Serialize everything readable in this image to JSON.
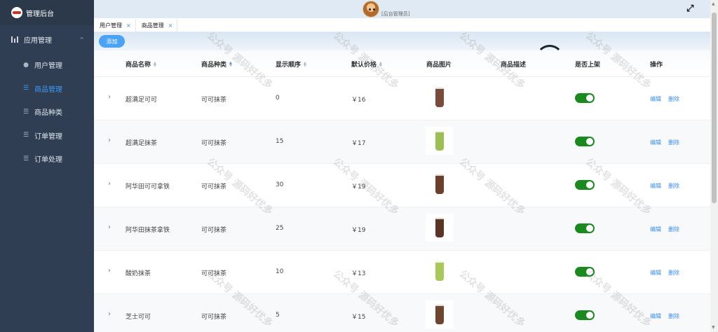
{
  "brand": {
    "title": "管理后台"
  },
  "sidebar": {
    "group": {
      "label": "应用管理",
      "chevron": "^"
    },
    "items": [
      {
        "label": "用户管理",
        "icon": "user-icon",
        "glyph": "●",
        "active": false
      },
      {
        "label": "商品管理",
        "icon": "sliders-icon",
        "glyph": "☰",
        "active": true
      },
      {
        "label": "商品种类",
        "icon": "sliders-icon",
        "glyph": "☰",
        "active": false
      },
      {
        "label": "订单管理",
        "icon": "sliders-icon",
        "glyph": "☰",
        "active": false
      },
      {
        "label": "订单处理",
        "icon": "sliders-icon",
        "glyph": "☰",
        "active": false
      }
    ]
  },
  "topbar": {
    "username": "[后台管理员]",
    "fullscreen_glyph": "⤢"
  },
  "tabs": [
    {
      "label": "用户管理",
      "close": "×"
    },
    {
      "label": "商品管理",
      "close": "×"
    }
  ],
  "toolbar": {
    "add_label": "添加"
  },
  "table": {
    "headers": [
      "商品名称",
      "商品种类",
      "显示顺序",
      "默认价格",
      "商品图片",
      "商品描述",
      "是否上架",
      "操作"
    ],
    "edit_label": "编辑",
    "delete_label": "删除",
    "expand_glyph": "›",
    "rows": [
      {
        "name": "超满足可可",
        "category": "可可抹茶",
        "order": "0",
        "price": "￥16",
        "on_sale": true,
        "cup_color": "#7a4a3a"
      },
      {
        "name": "超满足抹茶",
        "category": "可可抹茶",
        "order": "15",
        "price": "￥17",
        "on_sale": true,
        "cup_color": "#9bbf52"
      },
      {
        "name": "阿华田可可拿铁",
        "category": "可可抹茶",
        "order": "30",
        "price": "￥19",
        "on_sale": true,
        "cup_color": "#6b3f2a"
      },
      {
        "name": "阿华田抹茶拿铁",
        "category": "可可抹茶",
        "order": "25",
        "price": "￥19",
        "on_sale": true,
        "cup_color": "#5a3523"
      },
      {
        "name": "酸奶抹茶",
        "category": "可可抹茶",
        "order": "10",
        "price": "￥13",
        "on_sale": true,
        "cup_color": "#a8c95a"
      },
      {
        "name": "芝士可可",
        "category": "可可抹茶",
        "order": "5",
        "price": "￥15",
        "on_sale": true,
        "cup_color": "#6e4630"
      }
    ]
  },
  "watermark": {
    "text": "公众号 源码好优多"
  },
  "colors": {
    "sidebar": "#2f3e52",
    "accent": "#3a8ee6",
    "switch_on": "#1a8a1f"
  }
}
